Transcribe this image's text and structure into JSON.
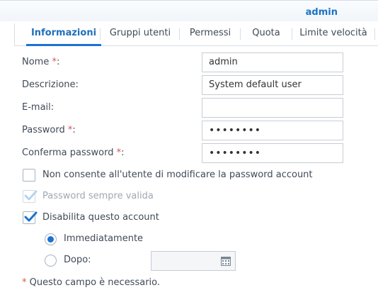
{
  "window": {
    "title": "admin"
  },
  "tabs": [
    {
      "label": "Informazioni",
      "active": true
    },
    {
      "label": "Gruppi utenti",
      "active": false
    },
    {
      "label": "Permessi",
      "active": false
    },
    {
      "label": "Quota",
      "active": false
    },
    {
      "label": "Limite velocità",
      "active": false
    }
  ],
  "form": {
    "name": {
      "label": "Nome",
      "required_mark": "*",
      "suffix": ":",
      "value": "admin"
    },
    "description": {
      "label": "Descrizione:",
      "value": "System default user"
    },
    "email": {
      "label": "E-mail:",
      "value": ""
    },
    "password": {
      "label": "Password",
      "required_mark": "*",
      "suffix": ":",
      "value": "••••••••"
    },
    "confirm": {
      "label": "Conferma password",
      "required_mark": "*",
      "suffix": ":",
      "value": "••••••••"
    }
  },
  "options": {
    "no_change_password": {
      "label": "Non consente all'utente di modificare la password account",
      "checked": false,
      "disabled": false
    },
    "password_always_valid": {
      "label": "Password sempre valida",
      "checked": true,
      "disabled": true
    },
    "disable_account": {
      "label": "Disabilita questo account",
      "checked": true,
      "disabled": false
    }
  },
  "disable_when": {
    "immediately": {
      "label": "Immediatamente",
      "selected": true
    },
    "after": {
      "label": "Dopo:",
      "selected": false,
      "date_value": ""
    }
  },
  "footer": {
    "required_mark": "*",
    "note": " Questo campo è necessario."
  },
  "colors": {
    "accent": "#1b73d0",
    "required": "#e25050",
    "text": "#404a56"
  },
  "icons": {
    "checkbox_check": "check-icon",
    "date_picker": "calendar-icon"
  }
}
